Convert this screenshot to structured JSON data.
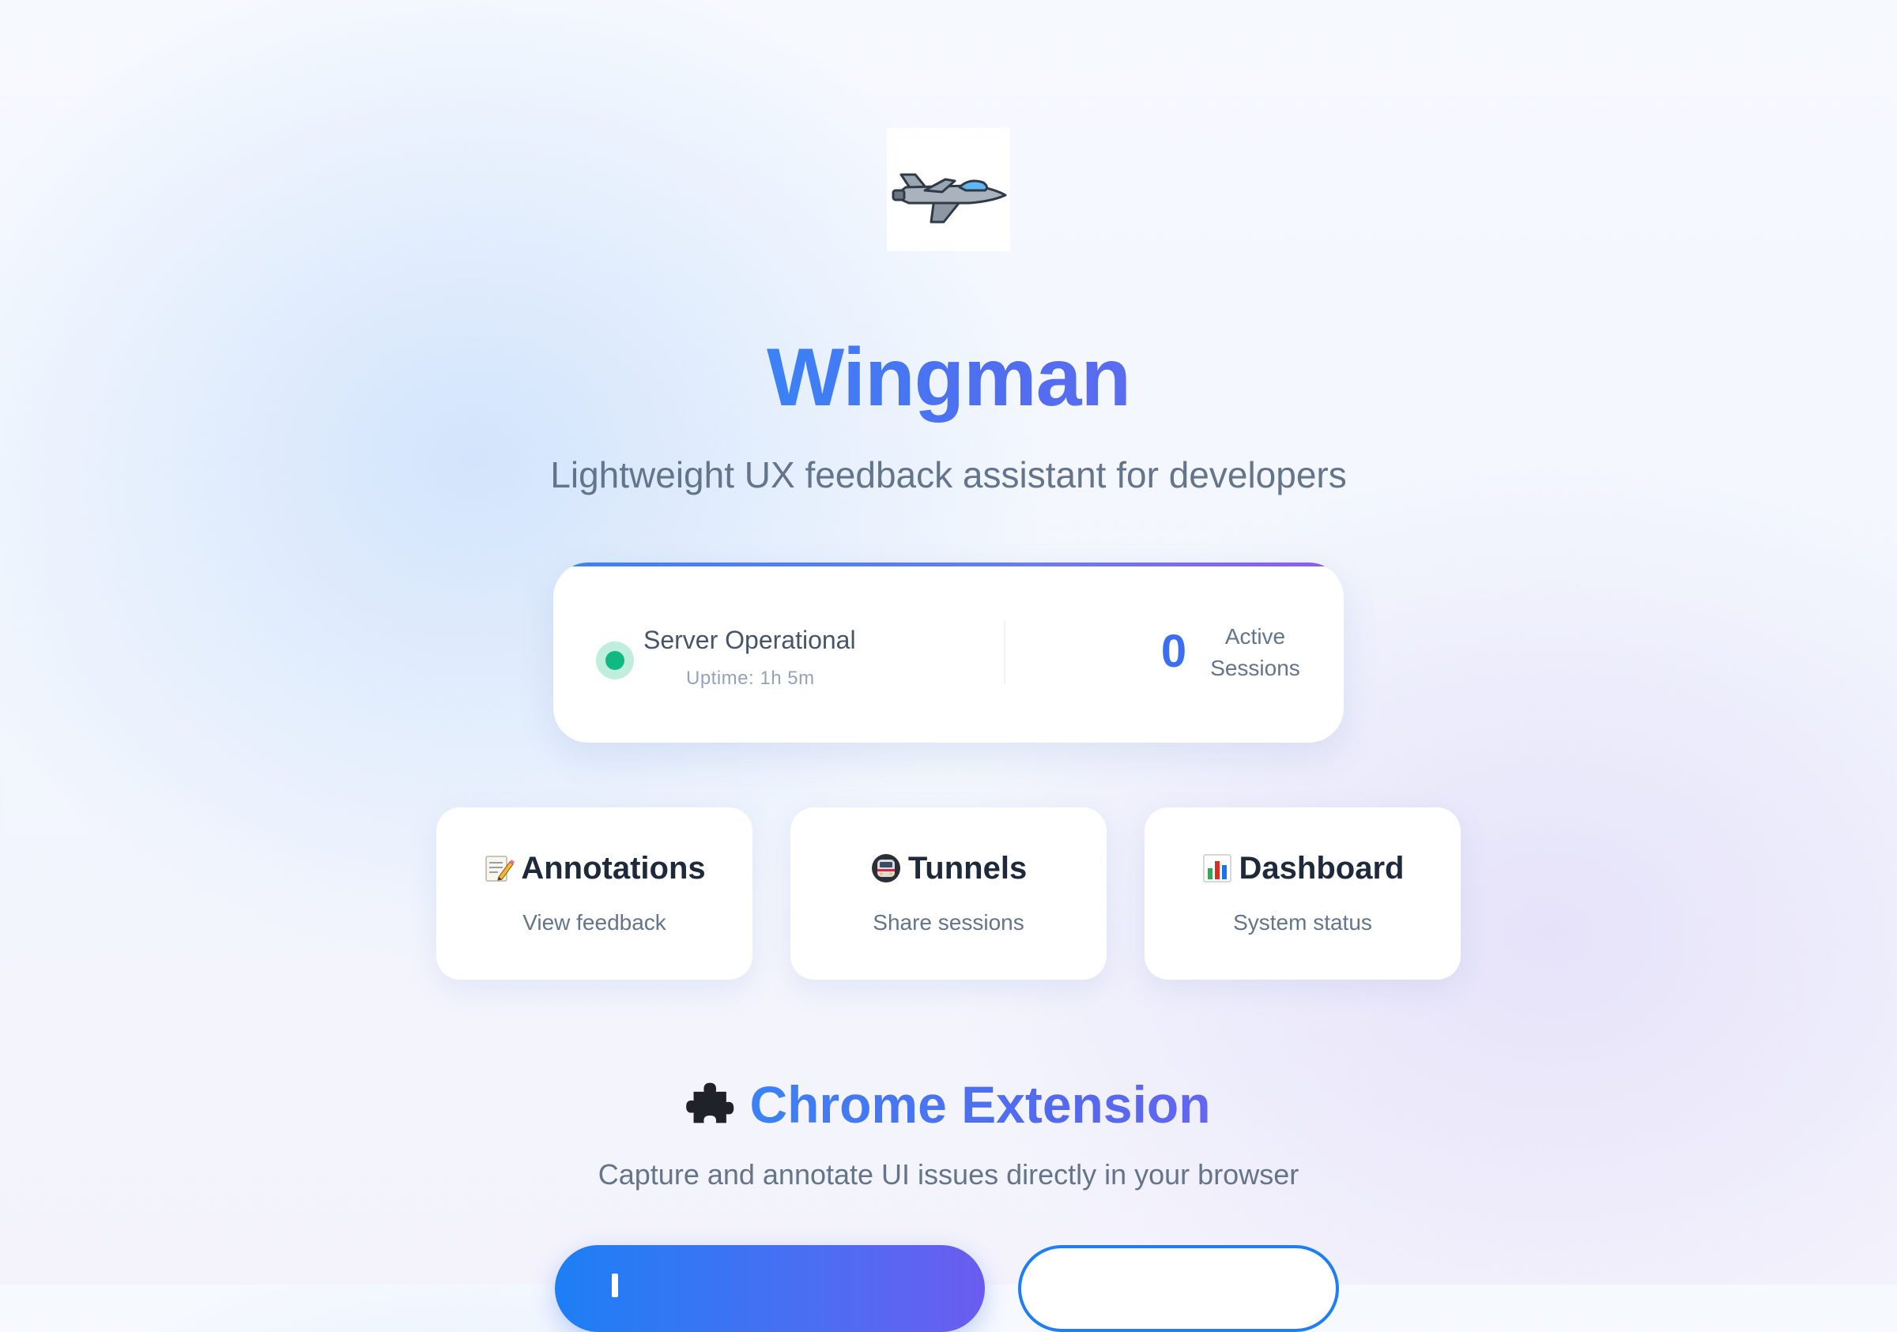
{
  "logo": {
    "icon": "fighter-jet-icon"
  },
  "header": {
    "title": "Wingman",
    "subtitle": "Lightweight UX feedback assistant for developers"
  },
  "status": {
    "label": "Server Operational",
    "uptime": "Uptime: 1h 5m",
    "state_color": "#10b981",
    "sessions_count": "0",
    "sessions_label": "Active Sessions"
  },
  "nav_cards": [
    {
      "icon": "memo-icon",
      "title": "Annotations",
      "subtitle": "View feedback"
    },
    {
      "icon": "metro-train-icon",
      "title": "Tunnels",
      "subtitle": "Share sessions"
    },
    {
      "icon": "bar-chart-icon",
      "title": "Dashboard",
      "subtitle": "System status"
    }
  ],
  "extension": {
    "icon": "puzzle-piece-icon",
    "title": "Chrome Extension",
    "subtitle": "Capture and annotate UI issues directly in your browser"
  },
  "colors": {
    "accent": "#3b6ef2",
    "accent_purple": "#6b5cf0",
    "text_muted": "#64748b",
    "success": "#10b981"
  }
}
